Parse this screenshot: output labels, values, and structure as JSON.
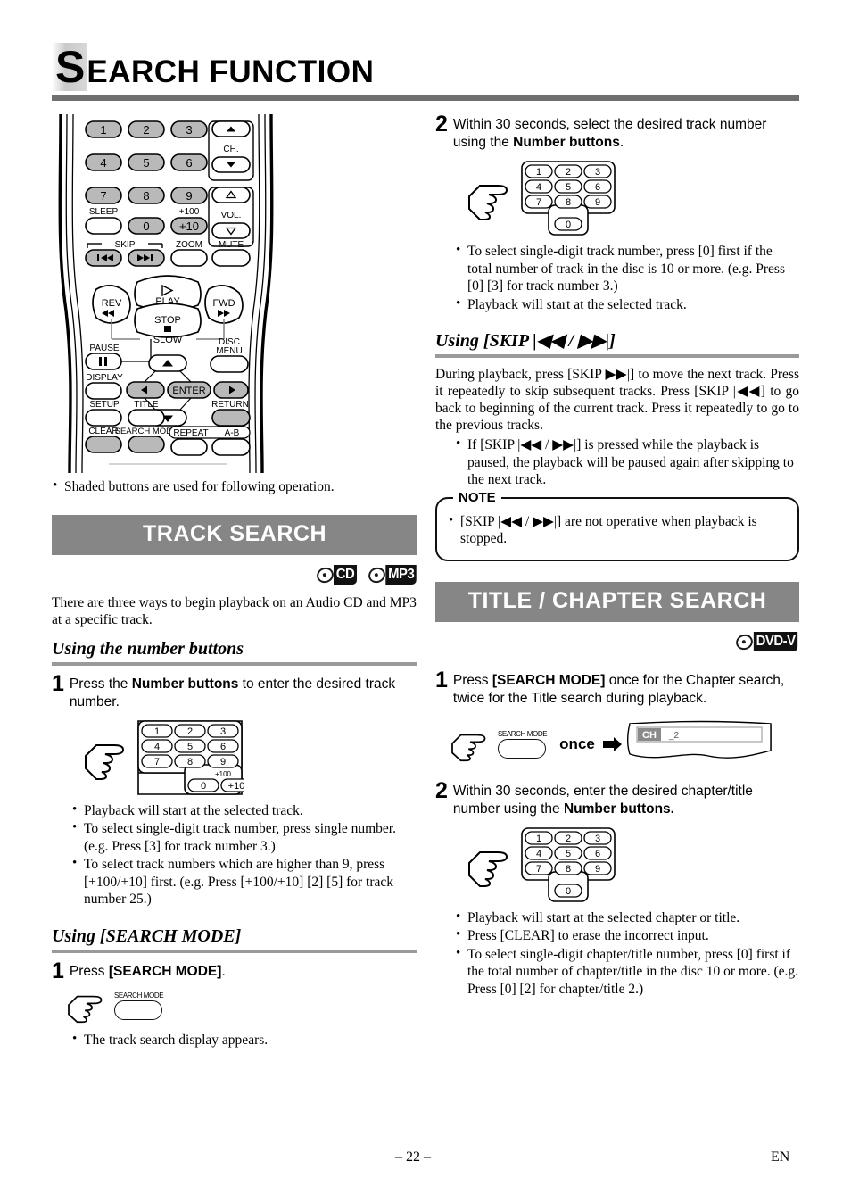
{
  "page": {
    "title_drop_cap": "S",
    "title_rest": "EARCH FUNCTION",
    "page_number": "– 22 –",
    "language_code": "EN"
  },
  "remote": {
    "caption": "Shaded buttons are used for following operation.",
    "keys": {
      "row1": [
        "1",
        "2",
        "3"
      ],
      "row2": [
        "4",
        "5",
        "6"
      ],
      "row3": [
        "7",
        "8",
        "9"
      ],
      "row4": [
        "SLEEP",
        "0",
        "+10"
      ],
      "plus100_label": "+100",
      "ch_label": "CH.",
      "vol_label": "VOL.",
      "skip_label": "SKIP",
      "zoom_label": "ZOOM",
      "mute_label": "MUTE",
      "play_label": "PLAY",
      "rev_label": "REV",
      "fwd_label": "FWD",
      "stop_label": "STOP",
      "slow_label": "SLOW",
      "pause_label": "PAUSE",
      "disc_menu_label_1": "DISC",
      "disc_menu_label_2": "MENU",
      "display_label": "DISPLAY",
      "enter_label": "ENTER",
      "setup_label": "SETUP",
      "title_label": "TITLE",
      "return_label": "RETURN",
      "clear_label": "CLEAR",
      "search_mode_label": "SEARCH MODE",
      "repeat_label": "REPEAT",
      "ab_label": "A-B"
    }
  },
  "track_search": {
    "banner": "TRACK SEARCH",
    "logos": [
      "CD",
      "MP3"
    ],
    "intro": "There are three ways to begin playback on an Audio CD and MP3 at a specific track.",
    "sub1": {
      "heading": "Using the number buttons",
      "step1_num": "1",
      "step1_text_a": "Press the ",
      "step1_text_b": "Number buttons",
      "step1_text_c": " to enter the desired track number.",
      "keypad": {
        "rows": [
          [
            "1",
            "2",
            "3"
          ],
          [
            "4",
            "5",
            "6"
          ],
          [
            "7",
            "8",
            "9"
          ]
        ],
        "bottom": [
          "0",
          "+10"
        ],
        "plus100": "+100"
      },
      "bullets": [
        "Playback will start at the selected track.",
        "To select single-digit track number, press single number. (e.g. Press [3] for track number 3.)",
        "To select track numbers which are higher than 9, press [+100/+10] first. (e.g. Press [+100/+10] [2] [5] for track number 25.)"
      ]
    },
    "sub2": {
      "heading": "Using [SEARCH MODE]",
      "step1_num": "1",
      "step1_text_a": "Press ",
      "step1_text_b": "[SEARCH MODE]",
      "step1_text_c": ".",
      "button_caption": "SEARCH MODE",
      "bullets": [
        "The track search display appears."
      ]
    },
    "step2": {
      "num": "2",
      "text_a": "Within 30 seconds, select the desired track number using the ",
      "text_b": "Number buttons",
      "text_c": ".",
      "keypad": {
        "rows": [
          [
            "1",
            "2",
            "3"
          ],
          [
            "4",
            "5",
            "6"
          ],
          [
            "7",
            "8",
            "9"
          ]
        ],
        "bottom": [
          "0"
        ]
      },
      "bullets": [
        "To select single-digit track number, press [0] first if the total number of track in the disc is 10 or more. (e.g. Press [0] [3] for track number 3.)",
        "Playback will start at the selected track."
      ]
    },
    "sub3": {
      "heading": "Using [SKIP |◀◀ / ▶▶|]",
      "body": "During playback, press [SKIP ▶▶|] to move the next track. Press it repeatedly to skip subsequent tracks. Press [SKIP |◀◀] to go back to beginning of the current track. Press it repeatedly to go to the previous tracks.",
      "bullets": [
        "If [SKIP |◀◀ / ▶▶|] is pressed while the playback is paused, the playback will be paused again after skipping to the next track."
      ],
      "note": {
        "title": "NOTE",
        "bullets": [
          "[SKIP |◀◀ / ▶▶|] are not operative when playback is stopped."
        ]
      }
    }
  },
  "title_chapter_search": {
    "banner": "TITLE / CHAPTER SEARCH",
    "logos": [
      "DVD-V"
    ],
    "step1": {
      "num": "1",
      "text_a": "Press ",
      "text_b": "[SEARCH MODE]",
      "text_c": " once for the Chapter search, twice for the Title search during playback.",
      "button_caption": "SEARCH MODE",
      "once_label": "once",
      "tv_display": {
        "badge": "CH",
        "value": "_2"
      }
    },
    "step2": {
      "num": "2",
      "text_a": "Within 30 seconds, enter the desired chapter/title number using the ",
      "text_b": "Number buttons.",
      "keypad": {
        "rows": [
          [
            "1",
            "2",
            "3"
          ],
          [
            "4",
            "5",
            "6"
          ],
          [
            "7",
            "8",
            "9"
          ]
        ],
        "bottom": [
          "0"
        ]
      },
      "bullets": [
        "Playback will start at the selected chapter or title.",
        "Press [CLEAR] to erase the incorrect input.",
        "To select single-digit chapter/title number, press [0] first if the total number of chapter/title in the disc 10 or more. (e.g. Press [0] [2] for chapter/title 2.)"
      ]
    }
  },
  "colors": {
    "banner_bg": "#868686",
    "rule": "#6f6f6f",
    "subrule": "#9a9a9a",
    "shaded_key": "#b9b9b9"
  }
}
